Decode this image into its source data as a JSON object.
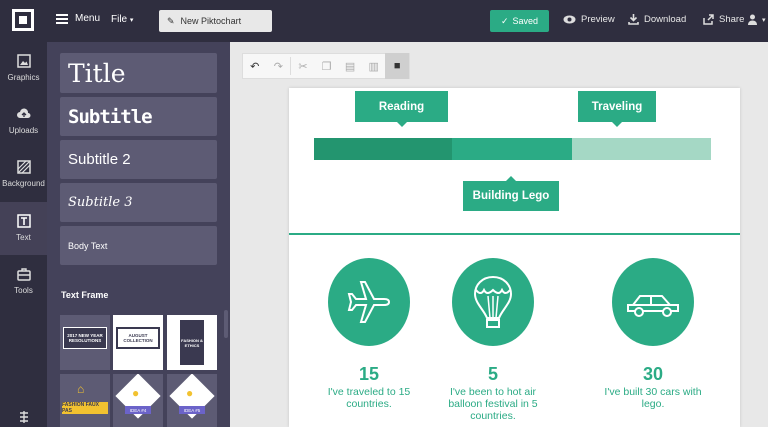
{
  "topbar": {
    "menu_label": "Menu",
    "file_label": "File",
    "title_value": "New Piktochart",
    "saved_label": "Saved",
    "preview_label": "Preview",
    "download_label": "Download",
    "share_label": "Share"
  },
  "rail": {
    "items": [
      {
        "label": "Graphics",
        "icon": "image-icon"
      },
      {
        "label": "Uploads",
        "icon": "cloud-upload-icon"
      },
      {
        "label": "Background",
        "icon": "background-icon"
      },
      {
        "label": "Text",
        "icon": "text-icon"
      },
      {
        "label": "Tools",
        "icon": "toolbox-icon"
      }
    ],
    "active": "Text"
  },
  "panel": {
    "text_options": [
      "Title",
      "Subtitle",
      "Subtitle 2",
      "Subtitle 3",
      "Body Text"
    ],
    "frame_label": "Text Frame",
    "frames": [
      {
        "text": "2017 NEW YEAR RESOLUTIONS"
      },
      {
        "text": "AUGUST COLLECTION"
      },
      {
        "text": "FASHION & ETHICS"
      },
      {
        "text": "FASHION FAUX PAS"
      },
      {
        "text": "IDEA #4"
      },
      {
        "text": "IDEA #5"
      }
    ]
  },
  "canvas": {
    "labels": {
      "reading": "Reading",
      "traveling": "Traveling",
      "lego": "Building Lego"
    },
    "stats": [
      {
        "number": "15",
        "text": "I've traveled to 15 countries.",
        "icon": "airplane-icon"
      },
      {
        "number": "5",
        "text": "I've been to hot air balloon festival in 5 countries.",
        "icon": "hot-air-balloon-icon"
      },
      {
        "number": "30",
        "text": "I've built 30 cars with lego.",
        "icon": "car-icon"
      }
    ]
  },
  "colors": {
    "accent": "#2bab85",
    "bar_dark": "#23956f",
    "bar_light": "#a5d8c5",
    "dark_bg": "#2f2e3f"
  }
}
